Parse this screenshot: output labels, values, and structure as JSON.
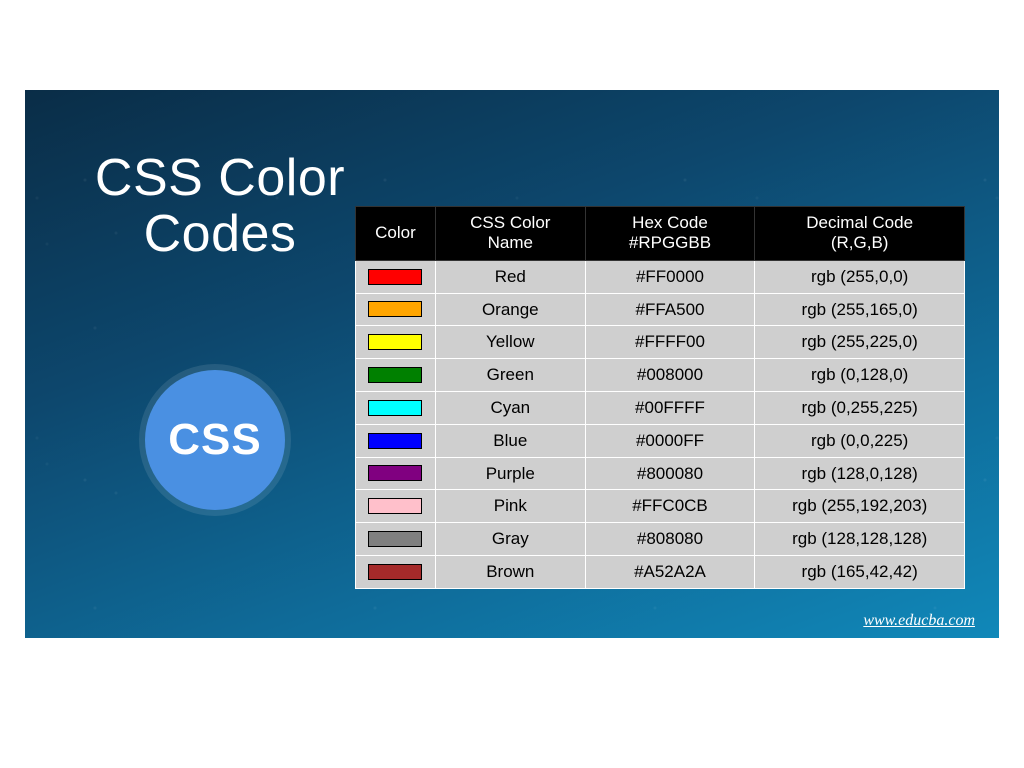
{
  "title_line1": "CSS Color",
  "title_line2": "Codes",
  "badge_text": "CSS",
  "footer_url": "www.educba.com",
  "headers": {
    "color": "Color",
    "name": "CSS Color\nName",
    "hex": "Hex Code\n#RPGGBB",
    "rgb": "Decimal Code\n(R,G,B)"
  },
  "chart_data": {
    "type": "table",
    "title": "CSS Color Codes",
    "columns": [
      "Color",
      "CSS Color Name",
      "Hex Code #RPGGBB",
      "Decimal Code (R,G,B)"
    ],
    "rows": [
      {
        "swatch": "#FF0000",
        "name": "Red",
        "hex": "#FF0000",
        "rgb": "rgb (255,0,0)"
      },
      {
        "swatch": "#FFA500",
        "name": "Orange",
        "hex": "#FFA500",
        "rgb": "rgb (255,165,0)"
      },
      {
        "swatch": "#FFFF00",
        "name": "Yellow",
        "hex": "#FFFF00",
        "rgb": "rgb (255,225,0)"
      },
      {
        "swatch": "#008000",
        "name": "Green",
        "hex": "#008000",
        "rgb": "rgb (0,128,0)"
      },
      {
        "swatch": "#00FFFF",
        "name": "Cyan",
        "hex": "#00FFFF",
        "rgb": "rgb (0,255,225)"
      },
      {
        "swatch": "#0000FF",
        "name": "Blue",
        "hex": "#0000FF",
        "rgb": "rgb (0,0,225)"
      },
      {
        "swatch": "#800080",
        "name": "Purple",
        "hex": "#800080",
        "rgb": "rgb (128,0,128)"
      },
      {
        "swatch": "#FFC0CB",
        "name": "Pink",
        "hex": "#FFC0CB",
        "rgb": "rgb (255,192,203)"
      },
      {
        "swatch": "#808080",
        "name": "Gray",
        "hex": "#808080",
        "rgb": "rgb (128,128,128)"
      },
      {
        "swatch": "#A52A2A",
        "name": "Brown",
        "hex": "#A52A2A",
        "rgb": "rgb (165,42,42)"
      }
    ]
  }
}
